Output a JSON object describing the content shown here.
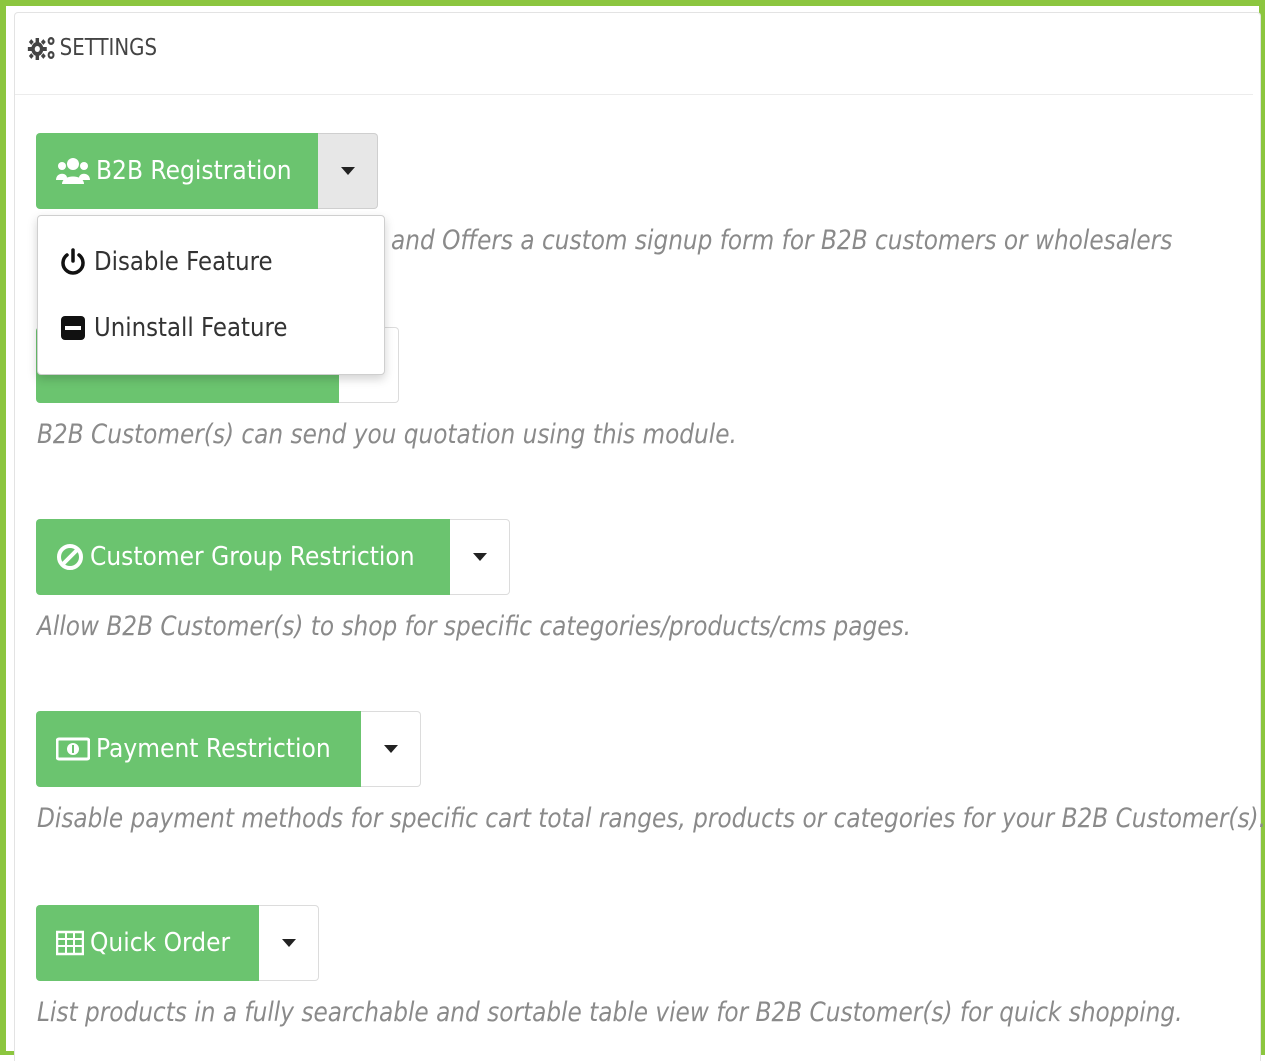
{
  "panel": {
    "title": "SETTINGS",
    "title_icon": "gears-icon"
  },
  "features": [
    {
      "button_label": "B2B Registration",
      "icon": "users-icon",
      "description": "and Offers a custom signup form for B2B customers or wholesalers",
      "dropdown_open": true
    },
    {
      "button_label": "",
      "icon": "",
      "description": "B2B Customer(s) can send you quotation using this module."
    },
    {
      "button_label": "Customer Group Restriction",
      "icon": "ban-icon",
      "description": "Allow B2B Customer(s) to shop for specific categories/products/cms pages."
    },
    {
      "button_label": "Payment Restriction",
      "icon": "money-icon",
      "description": "Disable payment methods for specific cart total ranges, products or categories for your B2B Customer(s)."
    },
    {
      "button_label": "Quick Order",
      "icon": "table-icon",
      "description": "List products in a fully searchable and sortable table view for B2B Customer(s) for quick shopping."
    }
  ],
  "dropdown": {
    "items": [
      {
        "label": "Disable Feature",
        "icon": "power-icon"
      },
      {
        "label": "Uninstall Feature",
        "icon": "minus-square-icon"
      }
    ]
  },
  "colors": {
    "frame_border": "#8cc63f",
    "button_green": "#6bc46f",
    "description_text": "#8a8a8a"
  }
}
